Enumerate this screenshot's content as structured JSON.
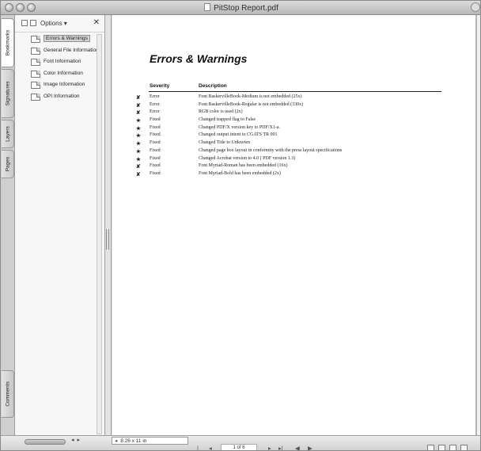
{
  "window": {
    "title": "PitStop Report.pdf"
  },
  "tabs": [
    {
      "label": "Bookmarks"
    },
    {
      "label": "Signatures"
    },
    {
      "label": "Layers"
    },
    {
      "label": "Pages"
    },
    {
      "label": "Comments"
    }
  ],
  "panel": {
    "options_label": "Options ▾",
    "close_label": "✕",
    "bookmarks": [
      {
        "label": "Errors & Warnings"
      },
      {
        "label": "General File Information"
      },
      {
        "label": "Font Information"
      },
      {
        "label": "Color Information"
      },
      {
        "label": "Image Information"
      },
      {
        "label": "OPI Information"
      }
    ]
  },
  "document": {
    "heading": "Errors & Warnings",
    "headers": {
      "severity": "Severity",
      "description": "Description"
    },
    "rows": [
      {
        "mark": "✘",
        "severity": "Error",
        "description": "Font BaskervilleBook-Medium is not embedded (25x)"
      },
      {
        "mark": "✘",
        "severity": "Error",
        "description": "Font BaskervilleBook-Regular is not embedded (330x)"
      },
      {
        "mark": "✘",
        "severity": "Error",
        "description": "RGB color is used (2x)"
      },
      {
        "mark": "★",
        "severity": "Fixed",
        "description": "Changed trapped flag to False"
      },
      {
        "mark": "★",
        "severity": "Fixed",
        "description": "Changed PDF/X version key to PDF/X1-a."
      },
      {
        "mark": "★",
        "severity": "Fixed",
        "description": "Changed output intent to CGATS TR 001"
      },
      {
        "mark": "★",
        "severity": "Fixed",
        "description": "Changed Title to Unknown"
      },
      {
        "mark": "★",
        "severity": "Fixed",
        "description": "Changed page box layout in conformity with the press layout specifications"
      },
      {
        "mark": "★",
        "severity": "Fixed",
        "description": "Changed Acrobat version to 4.0 ( PDF version 1.3)"
      },
      {
        "mark": "✘",
        "severity": "Fixed",
        "description": "Font Myriad-Roman has been embedded (16x)"
      },
      {
        "mark": "✘",
        "severity": "Fixed",
        "description": "Font Myriad-Bold has been embedded (2x)"
      }
    ]
  },
  "statusbar": {
    "page_size": "8.26 x 11 in",
    "page_size_arrow": "◂",
    "page_indicator": "1 of 6",
    "nav_arrows": "◂ ▸",
    "first_label": "|◂",
    "prev_label": "◂",
    "next_label": "▸",
    "last_label": "▸|",
    "back_label": "◀",
    "forward_label": "▶"
  }
}
